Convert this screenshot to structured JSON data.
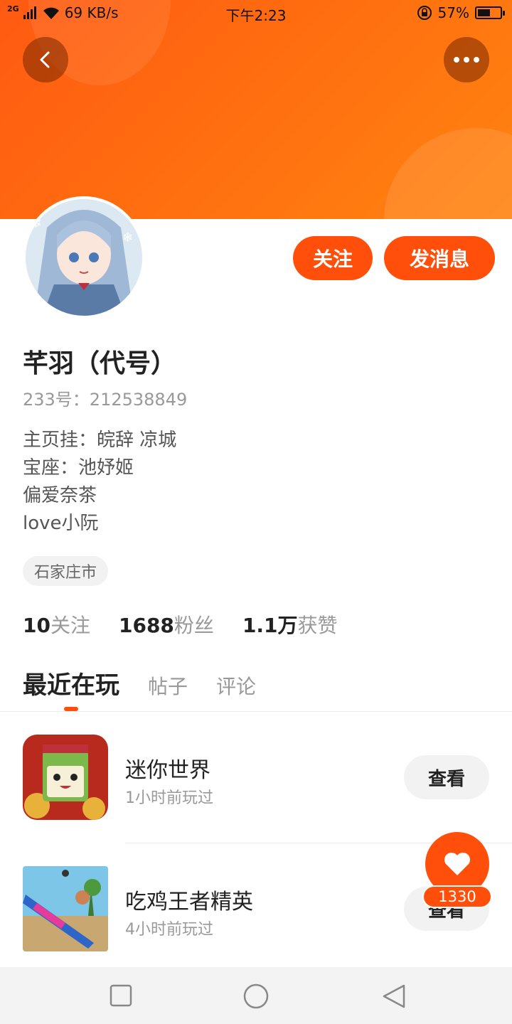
{
  "status_bar": {
    "network": "2G",
    "speed": "69 KB/s",
    "time": "下午2:23",
    "battery": "57%",
    "battery_level": 0.57
  },
  "header": {
    "back_icon": "back-arrow-icon",
    "more_icon": "more-dots-icon",
    "colors": {
      "banner_start": "#ff5a12",
      "banner_end": "#ff8410"
    }
  },
  "profile": {
    "name": "芊羽（代号）",
    "uid": "233号：212538849",
    "bio": [
      "主页挂：皖辞 凉城",
      "宝座：池妤姬",
      "偏爱奈茶",
      "love小阮"
    ],
    "location": "石家庄市",
    "follow_label": "关注",
    "message_label": "发消息",
    "accent": "#ff4f0b"
  },
  "stats": [
    {
      "num": "10",
      "label": "关注"
    },
    {
      "num": "1688",
      "label": "粉丝"
    },
    {
      "num": "1.1万",
      "label": "获赞"
    }
  ],
  "tabs": [
    {
      "label": "最近在玩",
      "active": true
    },
    {
      "label": "帖子",
      "active": false
    },
    {
      "label": "评论",
      "active": false
    }
  ],
  "games": [
    {
      "title": "迷你世界",
      "sub": "1小时前玩过",
      "button": "查看"
    },
    {
      "title": "吃鸡王者精英",
      "sub": "4小时前玩过",
      "button": "查看"
    }
  ],
  "like": {
    "count": "1330",
    "icon": "heart-icon"
  },
  "nav": {
    "recent_icon": "square-icon",
    "home_icon": "circle-icon",
    "back_icon": "triangle-back-icon"
  }
}
